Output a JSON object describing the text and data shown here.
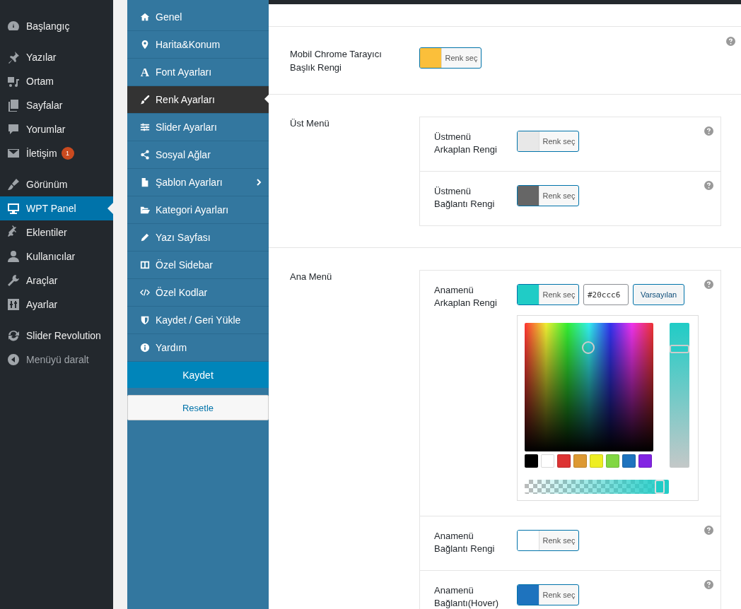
{
  "admin_menu": {
    "groups": [
      [
        {
          "label": "Başlangıç",
          "selected": false
        }
      ],
      [
        {
          "label": "Yazılar",
          "selected": false
        },
        {
          "label": "Ortam",
          "selected": false
        },
        {
          "label": "Sayfalar",
          "selected": false
        },
        {
          "label": "Yorumlar",
          "selected": false
        },
        {
          "label": "İletişim",
          "selected": false,
          "badge": "1"
        }
      ],
      [
        {
          "label": "Görünüm",
          "selected": false
        },
        {
          "label": "WPT Panel",
          "selected": true
        },
        {
          "label": "Eklentiler",
          "selected": false
        },
        {
          "label": "Kullanıcılar",
          "selected": false
        },
        {
          "label": "Araçlar",
          "selected": false
        },
        {
          "label": "Ayarlar",
          "selected": false
        }
      ],
      [
        {
          "label": "Slider Revolution",
          "selected": false
        },
        {
          "label": "Menüyü daralt",
          "selected": false,
          "kind": "collapse"
        }
      ]
    ]
  },
  "panel_nav": {
    "items": [
      {
        "label": "Genel",
        "selected": false
      },
      {
        "label": "Harita&Konum",
        "selected": false
      },
      {
        "label": "Font Ayarları",
        "selected": false,
        "icon_text": "A"
      },
      {
        "label": "Renk Ayarları",
        "selected": true
      },
      {
        "label": "Slider Ayarları",
        "selected": false
      },
      {
        "label": "Sosyal Ağlar",
        "selected": false
      },
      {
        "label": "Şablon Ayarları",
        "selected": false,
        "has_submenu": true
      },
      {
        "label": "Kategori Ayarları",
        "selected": false
      },
      {
        "label": "Yazı Sayfası",
        "selected": false
      },
      {
        "label": "Özel Sidebar",
        "selected": false
      },
      {
        "label": "Özel Kodlar",
        "selected": false
      },
      {
        "label": "Kaydet / Geri Yükle",
        "selected": false
      },
      {
        "label": "Yardım",
        "selected": false
      }
    ],
    "save_button": "Kaydet",
    "reset_button": "Resetle"
  },
  "settings": [
    {
      "kind": "single",
      "label": "Mobil Chrome Tarayıcı Başlık Rengi",
      "color": "#fbbf3a",
      "button": "Renk seç"
    },
    {
      "kind": "group",
      "label": "Üst Menü",
      "fields": [
        {
          "label": "Üstmenü Arkaplan Rengi",
          "color": "#e8e8e8",
          "button": "Renk seç"
        },
        {
          "label": "Üstmenü Bağlantı Rengi",
          "color": "#666666",
          "button": "Renk seç"
        }
      ]
    },
    {
      "kind": "group",
      "label": "Ana Menü",
      "fields": [
        {
          "label": "Anamenü Arkaplan Rengi",
          "color": "#20ccc6",
          "button": "Renk seç",
          "expanded": true,
          "hex_value": "#20ccc6",
          "default_button": "Varsayılan",
          "picker": {
            "palette": [
              {
                "color": "#000000"
              },
              {
                "color": "#ffffff"
              },
              {
                "color": "#dd3333"
              },
              {
                "color": "#dd9933"
              },
              {
                "color": "#eeee22"
              },
              {
                "color": "#81d742"
              },
              {
                "color": "#1e73be"
              },
              {
                "color": "#8224e3"
              }
            ],
            "saturation": {
              "level": 0.82
            },
            "opacity": {
              "level": 0.97
            }
          }
        },
        {
          "label": "Anamenü Bağlantı Rengi",
          "color": "#ffffff",
          "button": "Renk seç"
        },
        {
          "label": "Anamenü Bağlantı(Hover)",
          "color": "#1e73be",
          "button": "Renk seç"
        }
      ]
    }
  ]
}
